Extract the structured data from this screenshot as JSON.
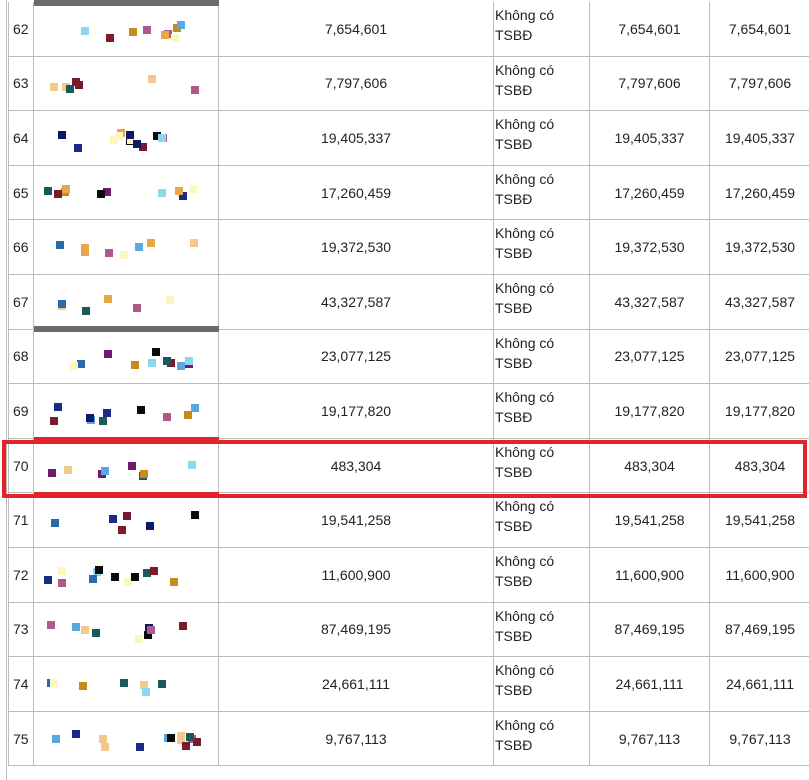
{
  "rows": [
    {
      "index": "62",
      "amount": "7,654,601",
      "collateral_line1": "Không có",
      "collateral_line2": "TSBĐ",
      "value1": "7,654,601",
      "value2": "7,654,601"
    },
    {
      "index": "63",
      "amount": "7,797,606",
      "collateral_line1": "Không có",
      "collateral_line2": "TSBĐ",
      "value1": "7,797,606",
      "value2": "7,797,606"
    },
    {
      "index": "64",
      "amount": "19,405,337",
      "collateral_line1": "Không có",
      "collateral_line2": "TSBĐ",
      "value1": "19,405,337",
      "value2": "19,405,337"
    },
    {
      "index": "65",
      "amount": "17,260,459",
      "collateral_line1": "Không có",
      "collateral_line2": "TSBĐ",
      "value1": "17,260,459",
      "value2": "17,260,459"
    },
    {
      "index": "66",
      "amount": "19,372,530",
      "collateral_line1": "Không có",
      "collateral_line2": "TSBĐ",
      "value1": "19,372,530",
      "value2": "19,372,530"
    },
    {
      "index": "67",
      "amount": "43,327,587",
      "collateral_line1": "Không có",
      "collateral_line2": "TSBĐ",
      "value1": "43,327,587",
      "value2": "43,327,587"
    },
    {
      "index": "68",
      "amount": "23,077,125",
      "collateral_line1": "Không có",
      "collateral_line2": "TSBĐ",
      "value1": "23,077,125",
      "value2": "23,077,125"
    },
    {
      "index": "69",
      "amount": "19,177,820",
      "collateral_line1": "Không có",
      "collateral_line2": "TSBĐ",
      "value1": "19,177,820",
      "value2": "19,177,820"
    },
    {
      "index": "70",
      "amount": "483,304",
      "collateral_line1": "Không có",
      "collateral_line2": "TSBĐ",
      "value1": "483,304",
      "value2": "483,304"
    },
    {
      "index": "71",
      "amount": "19,541,258",
      "collateral_line1": "Không có",
      "collateral_line2": "TSBĐ",
      "value1": "19,541,258",
      "value2": "19,541,258"
    },
    {
      "index": "72",
      "amount": "11,600,900",
      "collateral_line1": "Không có",
      "collateral_line2": "TSBĐ",
      "value1": "11,600,900",
      "value2": "11,600,900"
    },
    {
      "index": "73",
      "amount": "87,469,195",
      "collateral_line1": "Không có",
      "collateral_line2": "TSBĐ",
      "value1": "87,469,195",
      "value2": "87,469,195"
    },
    {
      "index": "74",
      "amount": "24,661,111",
      "collateral_line1": "Không có",
      "collateral_line2": "TSBĐ",
      "value1": "24,661,111",
      "value2": "24,661,111"
    },
    {
      "index": "75",
      "amount": "9,767,113",
      "collateral_line1": "Không có",
      "collateral_line2": "TSBĐ",
      "value1": "9,767,113",
      "value2": "9,767,113"
    }
  ],
  "highlighted_row_index": "70",
  "colors": {
    "highlight": "#e3222b",
    "grid": "#bcbcbc",
    "separator": "#6b6b6b"
  }
}
